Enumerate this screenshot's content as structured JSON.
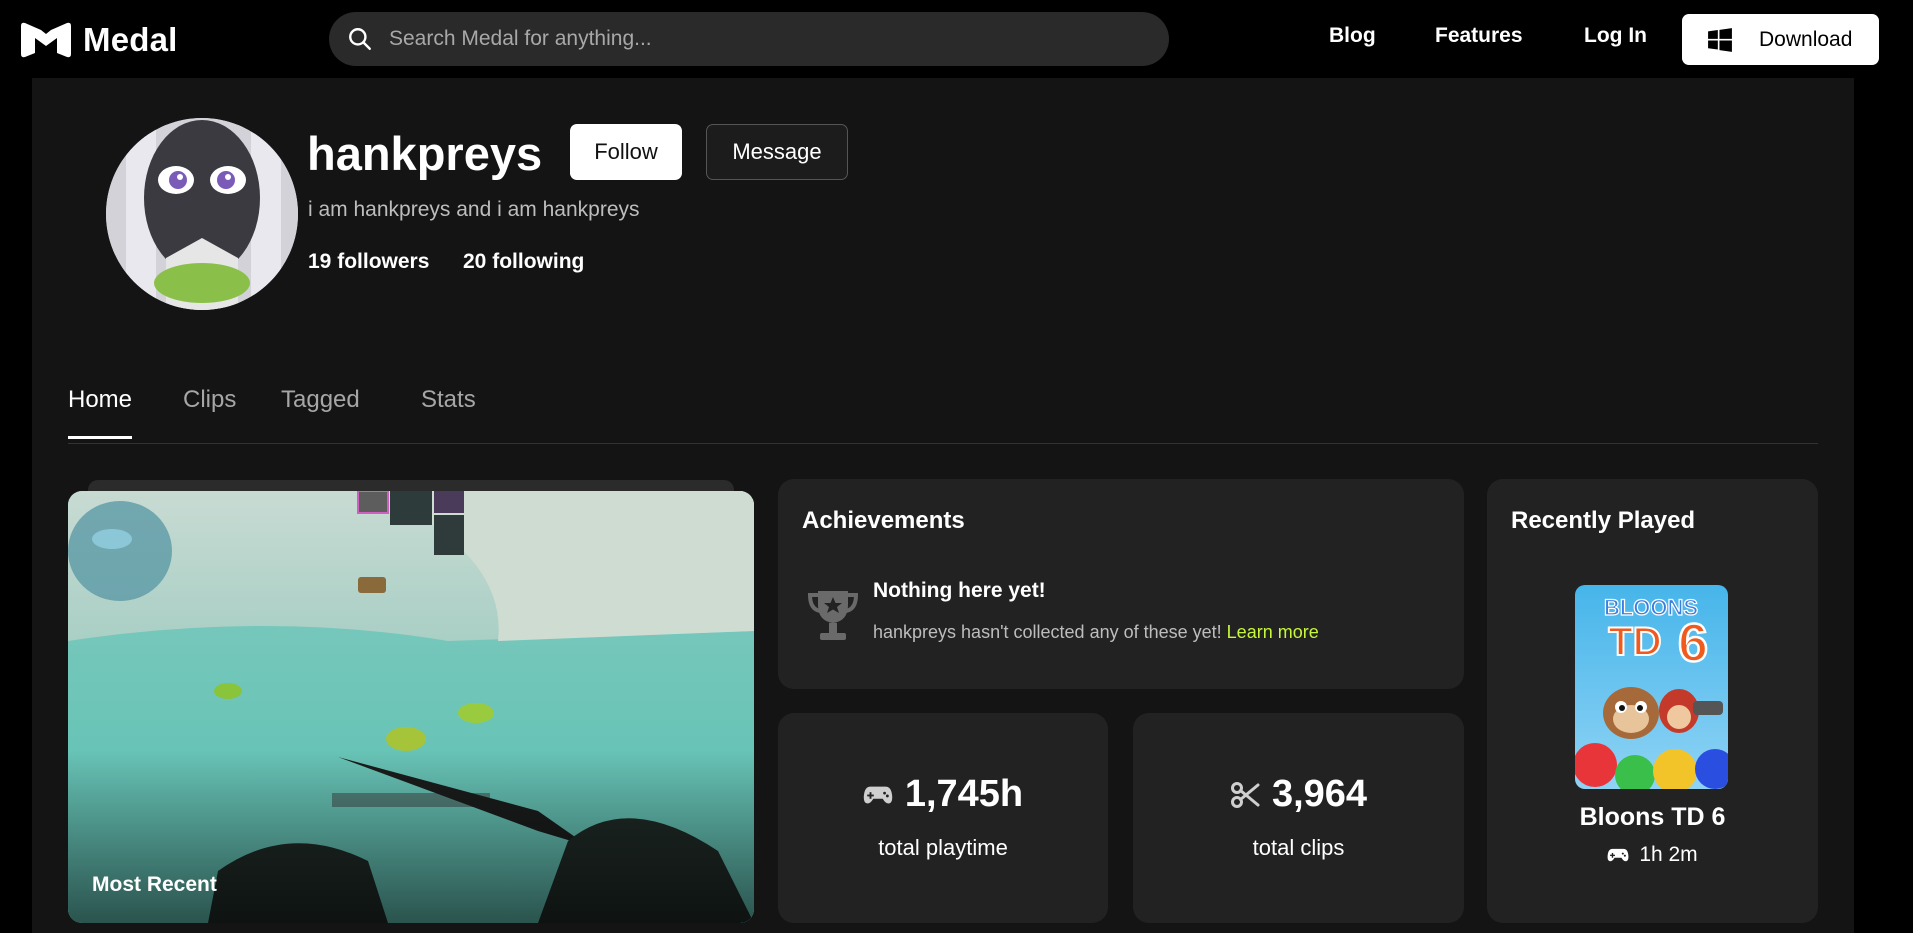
{
  "brand": {
    "name": "Medal"
  },
  "search": {
    "placeholder": "Search Medal for anything..."
  },
  "nav": {
    "blog": "Blog",
    "features": "Features",
    "login": "Log In",
    "download": "Download"
  },
  "profile": {
    "username": "hankpreys",
    "follow_label": "Follow",
    "message_label": "Message",
    "bio": "i am hankpreys and i am hankpreys",
    "followers_count": "19",
    "followers_label": "followers",
    "following_count": "20",
    "following_label": "following"
  },
  "tabs": [
    {
      "label": "Home",
      "active": true
    },
    {
      "label": "Clips",
      "active": false
    },
    {
      "label": "Tagged",
      "active": false
    },
    {
      "label": "Stats",
      "active": false
    }
  ],
  "clip": {
    "label": "Most Recent"
  },
  "achievements": {
    "title": "Achievements",
    "empty_title": "Nothing here yet!",
    "empty_text": "hankpreys hasn't collected any of these yet!",
    "learn_more": "Learn more"
  },
  "stats": {
    "playtime_value": "1,745h",
    "playtime_label": "total playtime",
    "clips_value": "3,964",
    "clips_label": "total clips"
  },
  "recently_played": {
    "title": "Recently Played",
    "game_name": "Bloons TD 6",
    "game_time": "1h 2m",
    "cover_text": "BLOONS TD 6"
  },
  "colors": {
    "accent_green": "#c5f73a",
    "background": "#000000",
    "panel": "#141414",
    "card": "#222222"
  }
}
